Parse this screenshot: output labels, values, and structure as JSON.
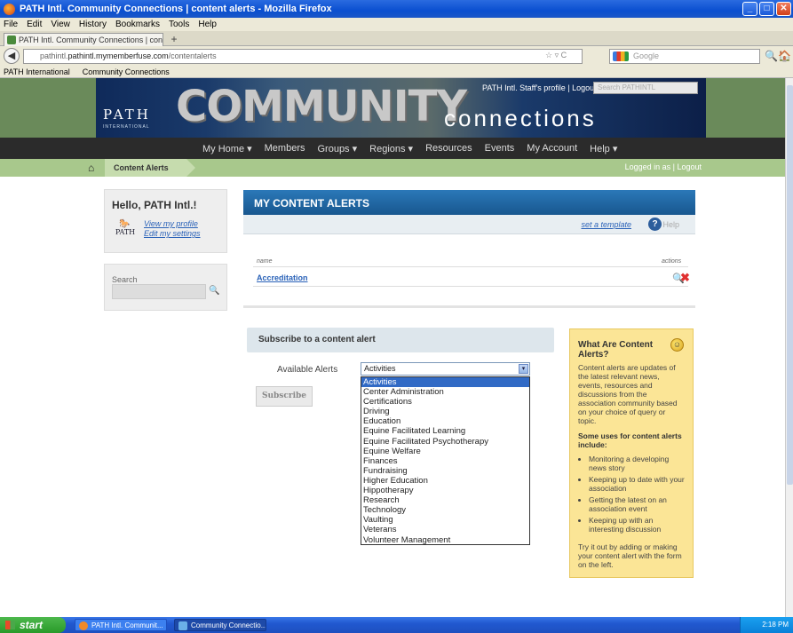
{
  "window": {
    "title": "PATH Intl. Community Connections | content alerts - Mozilla Firefox",
    "controls": [
      "_",
      "□",
      "✕"
    ]
  },
  "menu": [
    "File",
    "Edit",
    "View",
    "History",
    "Bookmarks",
    "Tools",
    "Help"
  ],
  "tab": {
    "label": "PATH Intl. Community Connections | content...",
    "new_tab": "+"
  },
  "nav": {
    "back": "◀",
    "url_domain": "pathintl.mymemberfuse.com",
    "url_path": "/contentalerts",
    "url_prefix": "pathintl.",
    "url_tools": "☆ ▿ C",
    "search_placeholder": "Google",
    "search_glass": "🔍",
    "home": "🏠"
  },
  "bookmarks": [
    "PATH International",
    "Community Connections"
  ],
  "site": {
    "logo": "PATH",
    "logo_sub": "INTERNATIONAL",
    "brand_word": "COMMUNITY",
    "brand_sub": "connections",
    "profile_link": "PATH Intl. Staff's profile",
    "logout": "Logout",
    "search_placeholder": "Search PATHINTL"
  },
  "main_nav": [
    "My Home ▾",
    "Members",
    "Groups ▾",
    "Regions ▾",
    "Resources",
    "Events",
    "My Account",
    "Help ▾"
  ],
  "breadcrumb": {
    "home_icon": "⌂",
    "current": "Content Alerts"
  },
  "session": {
    "logged_in_as": "Logged in as",
    "logout": "| Logout"
  },
  "sidebar": {
    "greeting": "Hello, PATH Intl.!",
    "avatar_text": "PATH",
    "view_profile": "View my profile",
    "edit_settings": "Edit my settings",
    "search_label": "Search",
    "search_glass": "🔍"
  },
  "alerts": {
    "title": "MY CONTENT ALERTS",
    "template_link": "set a template",
    "help_icon": "?",
    "help": "Help",
    "col_name": "name",
    "col_actions": "actions",
    "rows": [
      {
        "name": "Accreditation"
      }
    ],
    "magnify_icon": "🔍",
    "delete_icon": "✖"
  },
  "subscribe": {
    "title": "Subscribe to a content alert",
    "label": "Available Alerts",
    "selected": "Activities",
    "arrow": "▾",
    "button": "Subscribe",
    "options": [
      "Activities",
      "Center Administration",
      "Certifications",
      "Driving",
      "Education",
      "Equine Facilitated Learning",
      "Equine Facilitated Psychotherapy",
      "Equine Welfare",
      "Finances",
      "Fundraising",
      "Higher Education",
      "Hippotherapy",
      "Research",
      "Technology",
      "Vaulting",
      "Veterans",
      "Volunteer Management"
    ]
  },
  "info": {
    "title": "What Are Content Alerts?",
    "smile": "☺",
    "intro": "Content alerts are updates of the latest relevant news, events, resources and discussions from the association community based on your choice of query or topic.",
    "subtitle": "Some uses for content alerts include:",
    "uses": [
      "Monitoring a developing news story",
      "Keeping up to date with your association",
      "Getting the latest on an association event",
      "Keeping up with an interesting discussion"
    ],
    "footer": "Try it out by adding or making your content alert with the form on the left."
  },
  "taskbar": {
    "start": "start",
    "items": [
      "PATH Intl. Communit...",
      "Community Connectio..."
    ],
    "clock": "2:18 PM"
  }
}
